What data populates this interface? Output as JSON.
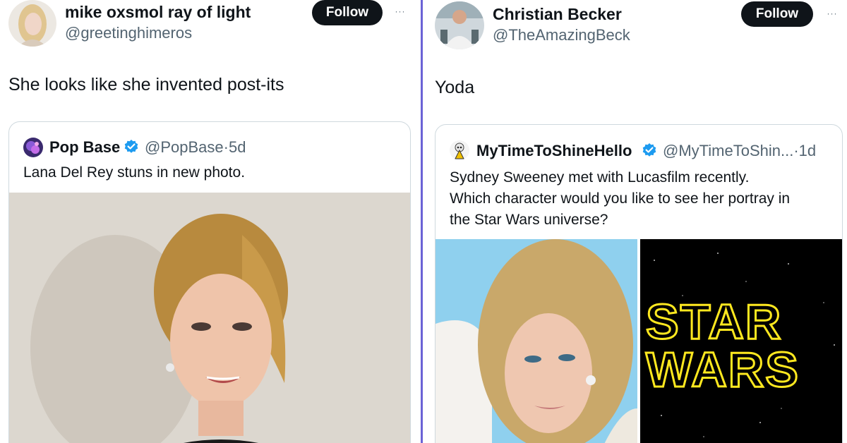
{
  "left_tweet": {
    "display_name": "mike oxsmol ray of light",
    "handle": "@greetinghimeros",
    "follow_label": "Follow",
    "more_label": "···",
    "text": "She looks like she invented post-its",
    "quote": {
      "display_name": "Pop Base",
      "handle": "@PopBase",
      "separator": "·",
      "time": "5d",
      "text": "Lana Del Rey stuns in new photo."
    }
  },
  "right_tweet": {
    "display_name": "Christian Becker",
    "handle": "@TheAmazingBeck",
    "follow_label": "Follow",
    "more_label": "···",
    "text": "Yoda",
    "quote": {
      "display_name": "MyTimeToShineHello",
      "handle": "@MyTimeToShin...",
      "separator": "·",
      "time": "1d",
      "text_lines": [
        "Sydney Sweeney met with Lucasfilm recently.",
        "Which character would you like to see her portray in",
        "the Star Wars universe?"
      ],
      "media_right_text": [
        "STAR",
        "WARS"
      ]
    }
  },
  "colors": {
    "divider": "#6b63d6",
    "verified": "#1d9bf0",
    "follow_bg": "#0f1419",
    "secondary_text": "#536471",
    "card_border": "#cfd9de"
  }
}
